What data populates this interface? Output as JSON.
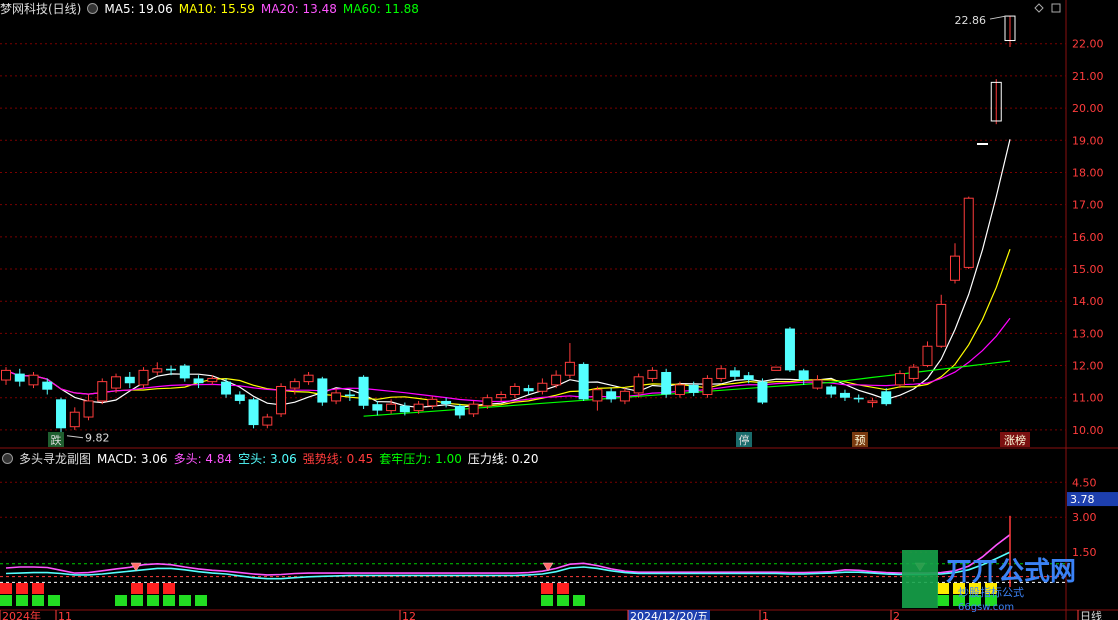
{
  "main_header": {
    "title": "梦网科技(日线)",
    "ma5": "MA5: 19.06",
    "ma10": "MA10: 15.59",
    "ma20": "MA20: 13.48",
    "ma60": "MA60: 11.88"
  },
  "sub_header": {
    "title": "多头寻龙副图",
    "macd": "MACD: 3.06",
    "duotou": "多头: 4.84",
    "kongtou": "空头: 3.06",
    "qiangshi": "强势线: 0.45",
    "taolao": "套牢压力: 1.00",
    "yali": "压力线: 0.20"
  },
  "colors": {
    "up": "#ff3c3c",
    "down": "#54ffff",
    "ma5": "#ffffff",
    "ma10": "#ffff00",
    "ma20": "#ff00ff",
    "ma60": "#00ff00",
    "grid": "#7a0000"
  },
  "watermark": {
    "text1": "丌丌公式网",
    "text2": "炒股指标公式",
    "url": "66gsw.com"
  },
  "chart_data": [
    {
      "type": "candlestick",
      "title": "梦网科技(日线)",
      "y_ticks": [
        10.0,
        11.0,
        12.0,
        13.0,
        14.0,
        15.0,
        16.0,
        17.0,
        18.0,
        19.0,
        20.0,
        21.0,
        22.0
      ],
      "ylim": [
        9.5,
        22.8
      ],
      "annotations": {
        "high": "22.86",
        "low": "9.82"
      },
      "markers": [
        "跌",
        "停",
        "预",
        "涨榜"
      ],
      "candles": [
        [
          11.55,
          11.85,
          11.95,
          11.4
        ],
        [
          11.75,
          11.5,
          11.9,
          11.35
        ],
        [
          11.4,
          11.7,
          11.8,
          11.3
        ],
        [
          11.5,
          11.25,
          11.6,
          11.1
        ],
        [
          10.95,
          10.05,
          11.0,
          9.82
        ],
        [
          10.1,
          10.55,
          10.7,
          10.0
        ],
        [
          10.4,
          10.9,
          11.1,
          10.3
        ],
        [
          10.9,
          11.5,
          11.6,
          10.8
        ],
        [
          11.3,
          11.65,
          11.75,
          11.15
        ],
        [
          11.65,
          11.45,
          11.8,
          11.3
        ],
        [
          11.4,
          11.85,
          11.95,
          11.3
        ],
        [
          11.8,
          11.9,
          12.1,
          11.7
        ],
        [
          11.9,
          11.85,
          12.0,
          11.7
        ],
        [
          12.0,
          11.6,
          12.05,
          11.5
        ],
        [
          11.6,
          11.45,
          11.7,
          11.3
        ],
        [
          11.5,
          11.6,
          11.7,
          11.4
        ],
        [
          11.5,
          11.1,
          11.6,
          11.0
        ],
        [
          11.1,
          10.9,
          11.2,
          10.8
        ],
        [
          10.95,
          10.15,
          11.0,
          10.05
        ],
        [
          10.15,
          10.4,
          10.5,
          10.05
        ],
        [
          10.5,
          11.35,
          11.45,
          10.4
        ],
        [
          11.3,
          11.5,
          11.6,
          11.1
        ],
        [
          11.5,
          11.7,
          11.8,
          11.4
        ],
        [
          11.6,
          10.85,
          11.65,
          10.75
        ],
        [
          10.9,
          11.15,
          11.3,
          10.8
        ],
        [
          11.1,
          11.05,
          11.25,
          10.9
        ],
        [
          11.65,
          10.75,
          11.7,
          10.65
        ],
        [
          10.8,
          10.6,
          10.9,
          10.45
        ],
        [
          10.6,
          10.8,
          10.95,
          10.5
        ],
        [
          10.75,
          10.55,
          10.85,
          10.45
        ],
        [
          10.6,
          10.8,
          10.9,
          10.5
        ],
        [
          10.75,
          10.95,
          11.05,
          10.65
        ],
        [
          10.9,
          10.8,
          11.0,
          10.7
        ],
        [
          10.75,
          10.45,
          10.8,
          10.35
        ],
        [
          10.5,
          10.8,
          10.9,
          10.4
        ],
        [
          10.75,
          11.0,
          11.1,
          10.65
        ],
        [
          11.0,
          11.1,
          11.2,
          10.9
        ],
        [
          11.1,
          11.35,
          11.45,
          11.0
        ],
        [
          11.3,
          11.2,
          11.4,
          11.1
        ],
        [
          11.2,
          11.45,
          11.6,
          11.1
        ],
        [
          11.4,
          11.7,
          11.85,
          11.3
        ],
        [
          11.7,
          12.1,
          12.7,
          11.6
        ],
        [
          12.05,
          10.95,
          12.1,
          10.9
        ],
        [
          10.9,
          11.25,
          11.35,
          10.6
        ],
        [
          11.2,
          10.95,
          11.3,
          10.85
        ],
        [
          10.9,
          11.2,
          11.3,
          10.8
        ],
        [
          11.15,
          11.65,
          11.75,
          11.0
        ],
        [
          11.6,
          11.85,
          11.95,
          11.5
        ],
        [
          11.8,
          11.1,
          11.9,
          11.0
        ],
        [
          11.1,
          11.4,
          11.5,
          11.0
        ],
        [
          11.4,
          11.15,
          11.5,
          11.05
        ],
        [
          11.1,
          11.6,
          11.7,
          11.0
        ],
        [
          11.6,
          11.9,
          12.0,
          11.5
        ],
        [
          11.85,
          11.65,
          11.95,
          11.55
        ],
        [
          11.7,
          11.55,
          11.8,
          11.45
        ],
        [
          11.5,
          10.85,
          11.6,
          10.8
        ],
        [
          11.85,
          11.95,
          11.95,
          11.85
        ],
        [
          13.15,
          11.85,
          13.2,
          11.8
        ],
        [
          11.85,
          11.55,
          11.9,
          11.4
        ],
        [
          11.3,
          11.55,
          11.7,
          11.25
        ],
        [
          11.35,
          11.1,
          11.4,
          11.0
        ],
        [
          11.15,
          11.0,
          11.25,
          10.9
        ],
        [
          11.0,
          10.95,
          11.1,
          10.85
        ],
        [
          10.85,
          10.9,
          11.0,
          10.7
        ],
        [
          11.2,
          10.8,
          11.3,
          10.75
        ],
        [
          11.4,
          11.75,
          11.85,
          11.3
        ],
        [
          11.6,
          11.95,
          12.05,
          11.5
        ],
        [
          12.0,
          12.6,
          12.75,
          11.95
        ],
        [
          12.6,
          13.9,
          14.2,
          12.55
        ],
        [
          14.65,
          15.4,
          15.8,
          14.55
        ],
        [
          15.05,
          17.2,
          17.25,
          15.0
        ],
        [
          18.9,
          18.9,
          18.9,
          18.9
        ],
        [
          19.6,
          20.8,
          20.9,
          19.5
        ],
        [
          22.1,
          22.86,
          22.86,
          21.9
        ]
      ]
    },
    {
      "type": "line",
      "title": "多头寻龙副图",
      "series": [
        {
          "name": "多头",
          "color": "#ff55ff",
          "values": [
            0.82,
            0.86,
            0.86,
            0.84,
            0.72,
            0.6,
            0.62,
            0.7,
            0.78,
            0.85,
            0.96,
            1.0,
            0.96,
            0.86,
            0.78,
            0.72,
            0.68,
            0.62,
            0.56,
            0.52,
            0.54,
            0.58,
            0.6,
            0.6,
            0.6,
            0.6,
            0.6,
            0.6,
            0.6,
            0.6,
            0.6,
            0.6,
            0.6,
            0.6,
            0.6,
            0.6,
            0.6,
            0.6,
            0.62,
            0.68,
            0.8,
            0.98,
            1.02,
            0.92,
            0.78,
            0.68,
            0.64,
            0.64,
            0.64,
            0.64,
            0.64,
            0.64,
            0.64,
            0.64,
            0.64,
            0.64,
            0.64,
            0.62,
            0.62,
            0.64,
            0.66,
            0.74,
            0.72,
            0.66,
            0.62,
            0.6,
            0.6,
            0.6,
            0.62,
            0.7,
            0.9,
            1.3,
            1.8,
            2.25,
            2.7,
            3.2,
            3.85,
            4.84
          ]
        },
        {
          "name": "空头",
          "color": "#54ffff",
          "values": [
            0.58,
            0.6,
            0.62,
            0.62,
            0.58,
            0.52,
            0.52,
            0.56,
            0.62,
            0.68,
            0.74,
            0.8,
            0.8,
            0.74,
            0.66,
            0.6,
            0.56,
            0.48,
            0.4,
            0.36,
            0.36,
            0.4,
            0.44,
            0.46,
            0.48,
            0.5,
            0.5,
            0.5,
            0.5,
            0.5,
            0.5,
            0.5,
            0.5,
            0.5,
            0.5,
            0.5,
            0.5,
            0.5,
            0.52,
            0.56,
            0.66,
            0.82,
            0.86,
            0.8,
            0.7,
            0.62,
            0.58,
            0.58,
            0.58,
            0.58,
            0.58,
            0.58,
            0.58,
            0.58,
            0.58,
            0.58,
            0.58,
            0.56,
            0.56,
            0.58,
            0.6,
            0.64,
            0.64,
            0.6,
            0.56,
            0.54,
            0.54,
            0.54,
            0.56,
            0.62,
            0.74,
            0.96,
            1.22,
            1.5,
            1.8,
            2.15,
            2.6,
            3.06
          ]
        }
      ],
      "levels": {
        "强势线": 0.45,
        "套牢压力": 1.0,
        "压力线": 0.2
      },
      "y_ticks": [
        1.5,
        3.0,
        4.5
      ],
      "current_label": "3.78",
      "x_labels": [
        "2024年",
        "11",
        "12",
        "2024/12/20/五",
        "1",
        "2",
        "日线"
      ]
    }
  ]
}
